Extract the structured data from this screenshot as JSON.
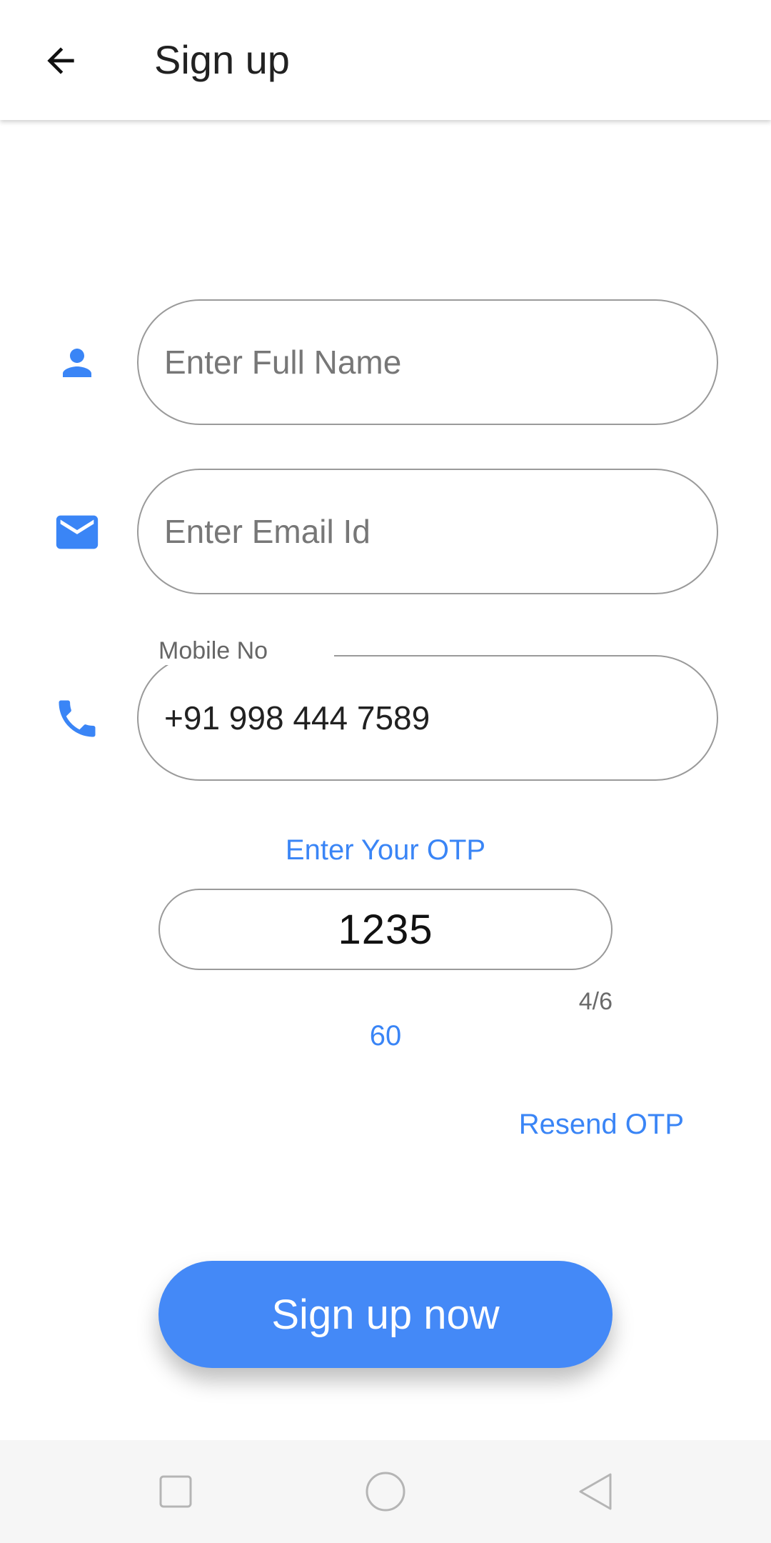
{
  "header": {
    "title": "Sign up",
    "back_icon": "arrow-left-icon"
  },
  "form": {
    "accent_color": "#3a85f6",
    "full_name": {
      "icon": "person-icon",
      "placeholder": "Enter Full Name",
      "value": ""
    },
    "email": {
      "icon": "mail-icon",
      "placeholder": "Enter Email Id",
      "value": ""
    },
    "mobile": {
      "icon": "phone-icon",
      "label": "Mobile No",
      "value": "+91 998 444 7589"
    },
    "otp": {
      "label": "Enter Your OTP",
      "value": "1235",
      "counter": "4/6",
      "timer": "60",
      "resend_label": "Resend OTP"
    },
    "submit_label": "Sign up now",
    "submit_color": "#4489f7"
  },
  "system_nav": {
    "items": [
      "recents-square-icon",
      "home-circle-icon",
      "back-triangle-icon"
    ]
  }
}
